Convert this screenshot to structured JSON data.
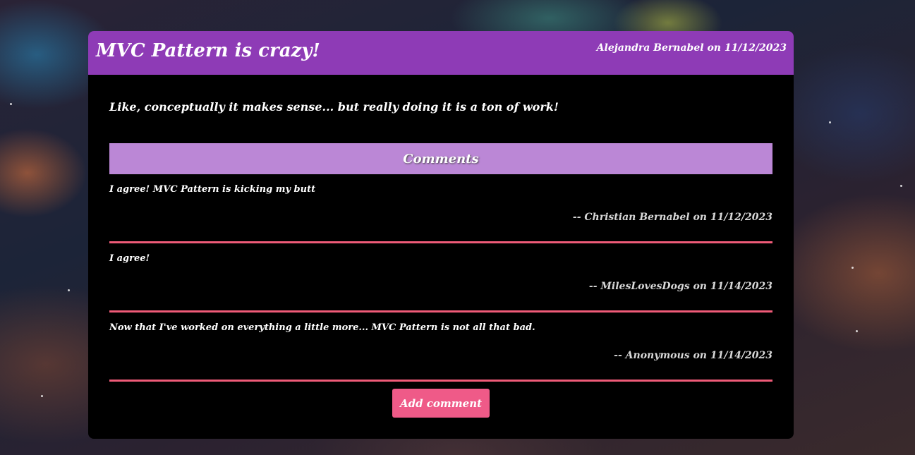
{
  "post": {
    "title": "MVC Pattern is crazy!",
    "meta": "Alejandra Bernabel on 11/12/2023",
    "body": "Like, conceptually it makes sense... but really doing it is a ton of work!"
  },
  "comments_section": {
    "heading": "Comments",
    "items": [
      {
        "text": "I agree! MVC Pattern is kicking my butt",
        "meta": "-- Christian Bernabel on 11/12/2023"
      },
      {
        "text": "I agree!",
        "meta": "-- MilesLovesDogs on 11/14/2023"
      },
      {
        "text": "Now that I've worked on everything a little more... MVC Pattern is not all that bad.",
        "meta": "-- Anonymous on 11/14/2023"
      }
    ],
    "add_button_label": "Add comment"
  },
  "colors": {
    "header": "#8e3bb6",
    "comments_heading": "#bb87d6",
    "accent": "#ef5a88",
    "divider": "#ef5b78",
    "card": "#000000"
  }
}
